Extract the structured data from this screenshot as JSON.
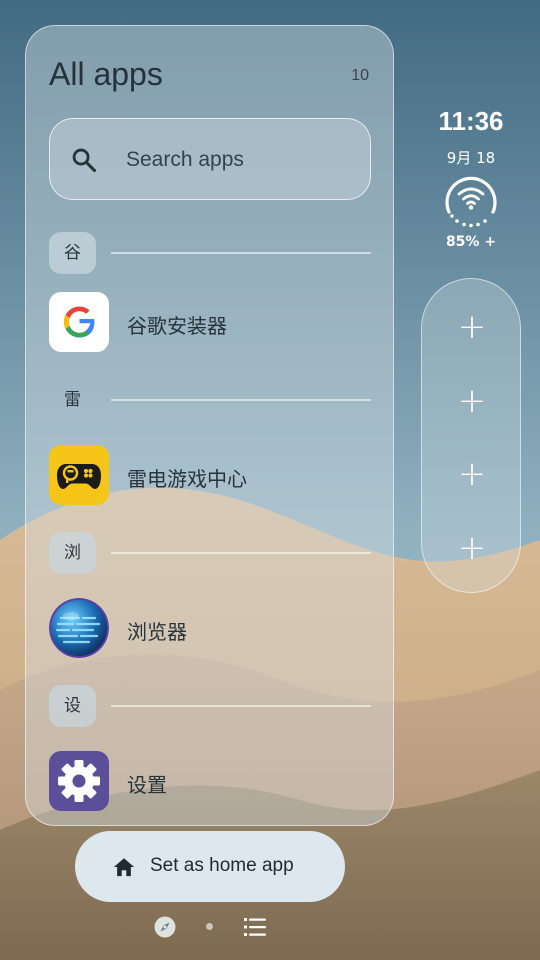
{
  "apps_panel": {
    "title": "All apps",
    "count": "10",
    "search_placeholder": "Search apps",
    "sections": [
      {
        "letter": "谷",
        "app": {
          "label": "谷歌安装器",
          "icon": "google-icon"
        }
      },
      {
        "letter": "雷",
        "app": {
          "label": "雷电游戏中心",
          "icon": "gamepad-icon"
        }
      },
      {
        "letter": "浏",
        "app": {
          "label": "浏览器",
          "icon": "globe-icon"
        }
      },
      {
        "letter": "设",
        "app": {
          "label": "设置",
          "icon": "gear-icon"
        }
      }
    ]
  },
  "status_widget": {
    "time": "11:36",
    "date": "9月 18",
    "battery": "85% +"
  },
  "shortcuts": [
    "+",
    "+",
    "+",
    "+"
  ],
  "home_button": {
    "label": "Set as home app"
  },
  "colors": {
    "sky_top": "#4d7389",
    "sand": "#c9a783",
    "panel_glass": "#d6e0e4",
    "home_button_bg": "#dde8ee",
    "gamepad_bg": "#f5c518",
    "settings_bg": "#5c4f9a"
  }
}
